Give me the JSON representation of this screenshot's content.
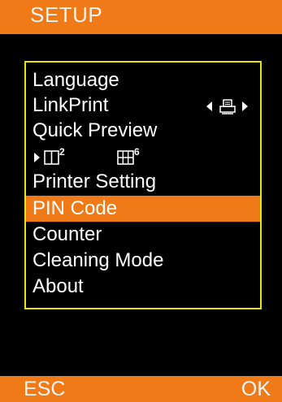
{
  "header": {
    "title": "SETUP"
  },
  "menu": {
    "items": [
      {
        "label": "Language"
      },
      {
        "label": "LinkPrint"
      },
      {
        "label": "Quick Preview"
      },
      {
        "label": "Printer Setting"
      },
      {
        "label": "PIN Code"
      },
      {
        "label": "Counter"
      },
      {
        "label": "Cleaning Mode"
      },
      {
        "label": "About"
      }
    ],
    "selected_label": "PIN Code"
  },
  "linkprint_value_icon": "printer-icon",
  "quick_preview_options": {
    "option_a": "2",
    "option_b": "6"
  },
  "footer": {
    "left_label": "ESC",
    "right_label": "OK"
  },
  "colors": {
    "accent": "#f07a18",
    "border": "#e8e414",
    "background": "#000000"
  }
}
